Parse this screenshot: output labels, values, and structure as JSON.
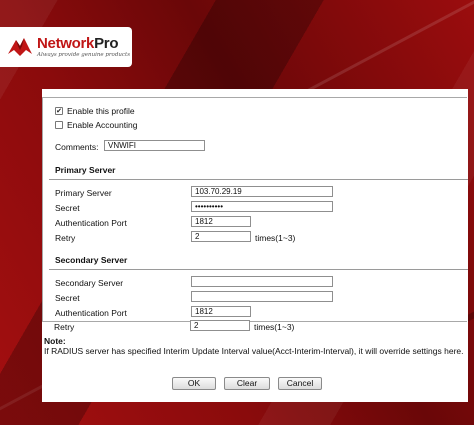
{
  "logo": {
    "brand_red": "Network",
    "brand_dark": "Pro",
    "tagline": "Always provide genuine products"
  },
  "profile": {
    "enable_profile_label": "Enable this profile",
    "enable_profile_checked": true,
    "enable_accounting_label": "Enable Accounting",
    "enable_accounting_checked": false,
    "comments_label": "Comments:",
    "comments_value": "VNWIFI"
  },
  "primary": {
    "section_title": "Primary Server",
    "server_label": "Primary Server",
    "server_value": "103.70.29.19",
    "secret_label": "Secret",
    "secret_value": "••••••••••",
    "auth_port_label": "Authentication Port",
    "auth_port_value": "1812",
    "retry_label": "Retry",
    "retry_value": "2",
    "retry_unit": "times(1~3)"
  },
  "secondary": {
    "section_title": "Secondary Server",
    "server_label": "Secondary Server",
    "server_value": "",
    "secret_label": "Secret",
    "secret_value": "",
    "auth_port_label": "Authentication Port",
    "auth_port_value": "1812",
    "retry_label": "Retry",
    "retry_value": "2",
    "retry_unit": "times(1~3)"
  },
  "note": {
    "title": "Note:",
    "text": "If RADIUS server has specified Interim Update Interval value(Acct-Interim-Interval), it will override settings here."
  },
  "buttons": {
    "ok": "OK",
    "clear": "Clear",
    "cancel": "Cancel"
  },
  "colors": {
    "brand_red": "#c01616",
    "backdrop_red": "#8a0b0c"
  }
}
